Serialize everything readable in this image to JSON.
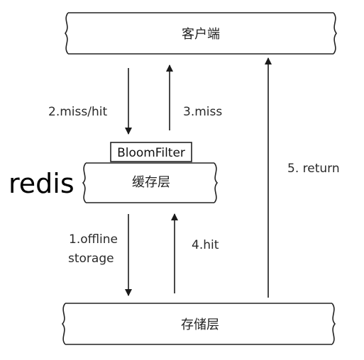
{
  "nodes": {
    "client": "客户端",
    "cache": "缓存层",
    "storage": "存储层",
    "bloom_filter": "BloomFilter",
    "redis": "redis"
  },
  "edges": {
    "miss_hit": "2.miss/hit",
    "miss": "3.miss",
    "offline_storage_line1": "1.offline",
    "offline_storage_line2": "storage",
    "hit": "4.hit",
    "return": "5. return"
  }
}
